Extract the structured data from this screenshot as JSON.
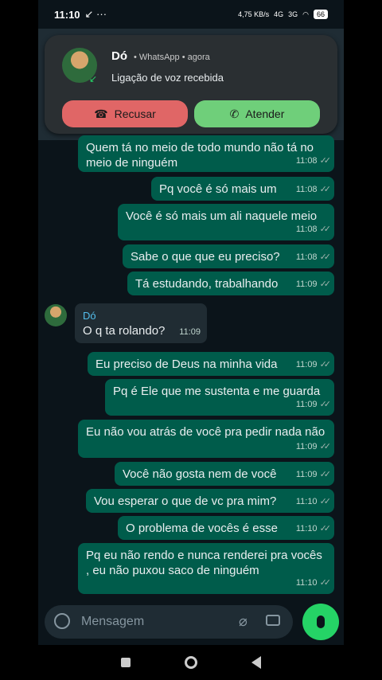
{
  "status": {
    "time": "11:10",
    "icons_left": "↙ ···",
    "speed": "4,75 KB/s",
    "net1": "4G",
    "net2": "3G",
    "battery": "66"
  },
  "notification": {
    "name": "Dó",
    "meta": "• WhatsApp • agora",
    "text": "Ligação de voz recebida",
    "decline_label": "Recusar",
    "accept_label": "Atender"
  },
  "messages": [
    {
      "text": "Quem tá no meio de todo mundo não tá no meio de ninguém",
      "time": "11:08"
    },
    {
      "text": "Pq você é só mais um",
      "time": "11:08"
    },
    {
      "text": "Você é só mais um ali naquele meio",
      "time": "11:08"
    },
    {
      "text": "Sabe o que que eu preciso?",
      "time": "11:08"
    },
    {
      "text": "Tá estudando, trabalhando",
      "time": "11:09"
    },
    {
      "sender": "Dó",
      "text": "O q ta rolando?",
      "time": "11:09"
    },
    {
      "text": "Eu preciso de Deus na minha vida",
      "time": "11:09"
    },
    {
      "text": "Pq é Ele que me sustenta e me guarda",
      "time": "11:09"
    },
    {
      "text": "Eu não vou atrás de você pra pedir nada não",
      "time": "11:09"
    },
    {
      "text": "Você não gosta nem de você",
      "time": "11:09"
    },
    {
      "text": "Vou esperar o que de vc pra mim?",
      "time": "11:10"
    },
    {
      "text": "O problema de vocês é esse",
      "time": "11:10"
    },
    {
      "text": "Pq eu não rendo e nunca renderei pra vocês , eu não puxou saco de ninguém",
      "time": "11:10"
    }
  ],
  "input": {
    "placeholder": "Mensagem"
  },
  "colors": {
    "outgoing": "#005c4b",
    "incoming": "#202c33",
    "accent": "#25d366"
  }
}
